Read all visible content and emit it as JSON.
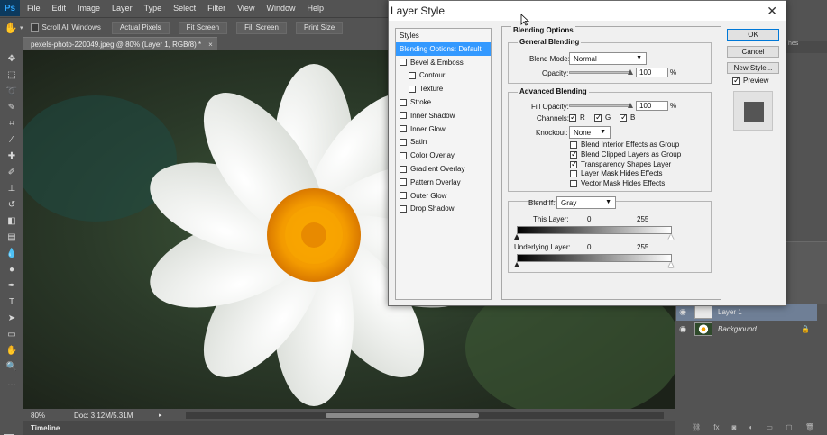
{
  "app": {
    "logo": "Ps",
    "menu": [
      "File",
      "Edit",
      "Image",
      "Layer",
      "Type",
      "Select",
      "Filter",
      "View",
      "Window",
      "Help"
    ]
  },
  "options_bar": {
    "scroll_all_windows": "Scroll All Windows",
    "buttons": [
      "Actual Pixels",
      "Fit Screen",
      "Fill Screen",
      "Print Size"
    ]
  },
  "document": {
    "tab_title": "pexels-photo-220049.jpeg @ 80% (Layer 1, RGB/8) *",
    "close": "×",
    "zoom": "80%",
    "doc_info": "Doc: 3.12M/5.31M"
  },
  "timeline": {
    "label": "Timeline"
  },
  "panel_strip": {
    "label": "hes"
  },
  "layers": [
    {
      "name": "Layer 1",
      "selected": true
    },
    {
      "name": "Background",
      "selected": false,
      "locked": true
    }
  ],
  "dialog": {
    "title": "Layer Style",
    "close": "✕",
    "styles_header": "Styles",
    "styles": [
      {
        "label": "Blending Options: Default",
        "checkbox": false,
        "selected": true
      },
      {
        "label": "Bevel & Emboss",
        "checkbox": true
      },
      {
        "label": "Contour",
        "checkbox": true,
        "sub": true
      },
      {
        "label": "Texture",
        "checkbox": true,
        "sub": true
      },
      {
        "label": "Stroke",
        "checkbox": true
      },
      {
        "label": "Inner Shadow",
        "checkbox": true
      },
      {
        "label": "Inner Glow",
        "checkbox": true
      },
      {
        "label": "Satin",
        "checkbox": true
      },
      {
        "label": "Color Overlay",
        "checkbox": true
      },
      {
        "label": "Gradient Overlay",
        "checkbox": true
      },
      {
        "label": "Pattern Overlay",
        "checkbox": true
      },
      {
        "label": "Outer Glow",
        "checkbox": true
      },
      {
        "label": "Drop Shadow",
        "checkbox": true
      }
    ],
    "blending_options": {
      "title": "Blending Options",
      "general": {
        "title": "General Blending",
        "blend_mode_label": "Blend Mode:",
        "blend_mode": "Normal",
        "opacity_label": "Opacity:",
        "opacity": "100",
        "percent": "%"
      },
      "advanced": {
        "title": "Advanced Blending",
        "fill_opacity_label": "Fill Opacity:",
        "fill_opacity": "100",
        "percent": "%",
        "channels_label": "Channels:",
        "channels": [
          "R",
          "G",
          "B"
        ],
        "knockout_label": "Knockout:",
        "knockout": "None",
        "options": [
          {
            "label": "Blend Interior Effects as Group",
            "checked": false
          },
          {
            "label": "Blend Clipped Layers as Group",
            "checked": true
          },
          {
            "label": "Transparency Shapes Layer",
            "checked": true
          },
          {
            "label": "Layer Mask Hides Effects",
            "checked": false
          },
          {
            "label": "Vector Mask Hides Effects",
            "checked": false
          }
        ]
      },
      "blend_if": {
        "label": "Blend If:",
        "value": "Gray",
        "this_layer_label": "This Layer:",
        "this_layer_min": "0",
        "this_layer_max": "255",
        "underlying_label": "Underlying Layer:",
        "underlying_min": "0",
        "underlying_max": "255"
      }
    },
    "buttons": {
      "ok": "OK",
      "cancel": "Cancel",
      "new_style": "New Style..."
    },
    "preview_label": "Preview",
    "preview_checked": true
  }
}
